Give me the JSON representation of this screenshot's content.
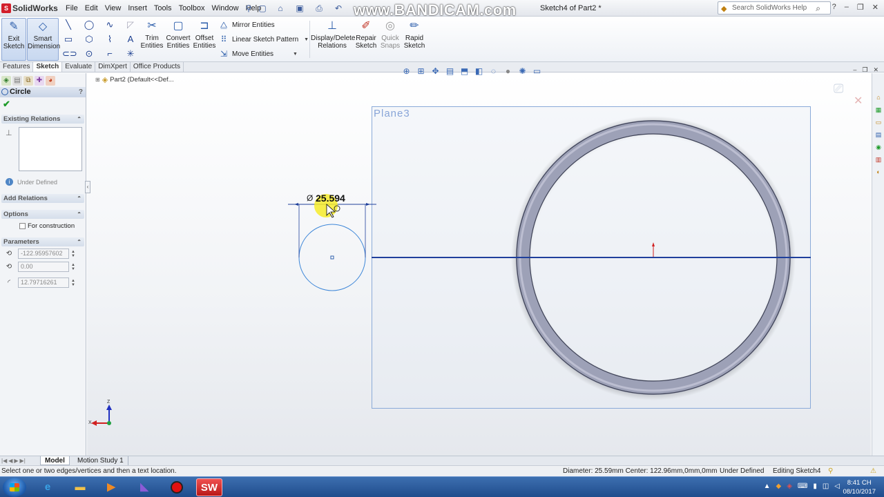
{
  "app": {
    "logo_text": "SolidWorks",
    "document_title": "Sketch4 of Part2 *",
    "recorder_watermark": "www.BANDICAM.com",
    "menus": [
      "File",
      "Edit",
      "View",
      "Insert",
      "Tools",
      "Toolbox",
      "Window",
      "Help"
    ],
    "help_search_placeholder": "Search SolidWorks Help"
  },
  "command_manager": {
    "exit_sketch": "Exit\nSketch",
    "smart_dimension": "Smart\nDimension",
    "trim_entities": "Trim\nEntities",
    "convert_entities": "Convert\nEntities",
    "offset_entities": "Offset\nEntities",
    "mirror_entities": "Mirror Entities",
    "linear_sketch_pattern": "Linear Sketch Pattern",
    "move_entities": "Move Entities",
    "display_delete_relations": "Display/Delete\nRelations",
    "repair_sketch": "Repair\nSketch",
    "quick_snaps": "Quick\nSnaps",
    "rapid_sketch": "Rapid\nSketch"
  },
  "tabs": [
    {
      "label": "Features",
      "active": false
    },
    {
      "label": "Sketch",
      "active": true
    },
    {
      "label": "Evaluate",
      "active": false
    },
    {
      "label": "DimXpert",
      "active": false
    },
    {
      "label": "Office Products",
      "active": false
    }
  ],
  "property_manager": {
    "title": "Circle",
    "help": "?",
    "sections": {
      "existing_relations": "Existing Relations",
      "add_relations": "Add Relations",
      "options": "Options",
      "parameters": "Parameters"
    },
    "status": "Under Defined",
    "for_construction": "For construction",
    "params": {
      "center_x": "-122.95957602",
      "center_y": "0.00",
      "radius": "12.79716261"
    }
  },
  "feature_tree": {
    "root": "Part2  (Default<<Def..."
  },
  "graphics": {
    "plane_label": "Plane3",
    "dimension_symbol": "Ø",
    "dimension_value": "25.594",
    "triad_axis_y": "Z",
    "triad_axis_x": "X"
  },
  "bottom_tabs": {
    "model": "Model",
    "motion_study": "Motion Study 1"
  },
  "status_bar": {
    "message": "Select one or two edges/vertices and then a text location.",
    "diameter": "Diameter: 25.59mm  Center: 122.96mm,0mm,0mm",
    "definition": "Under Defined",
    "editing": "Editing Sketch4"
  },
  "taskbar": {
    "time": "8:41 CH",
    "date": "08/10/2017"
  },
  "colors": {
    "sketch_blue": "#1f3f9b",
    "circle_blue": "#3d86d8",
    "plane_border": "#8aaad8",
    "solidworks_red": "#d21f2b"
  }
}
